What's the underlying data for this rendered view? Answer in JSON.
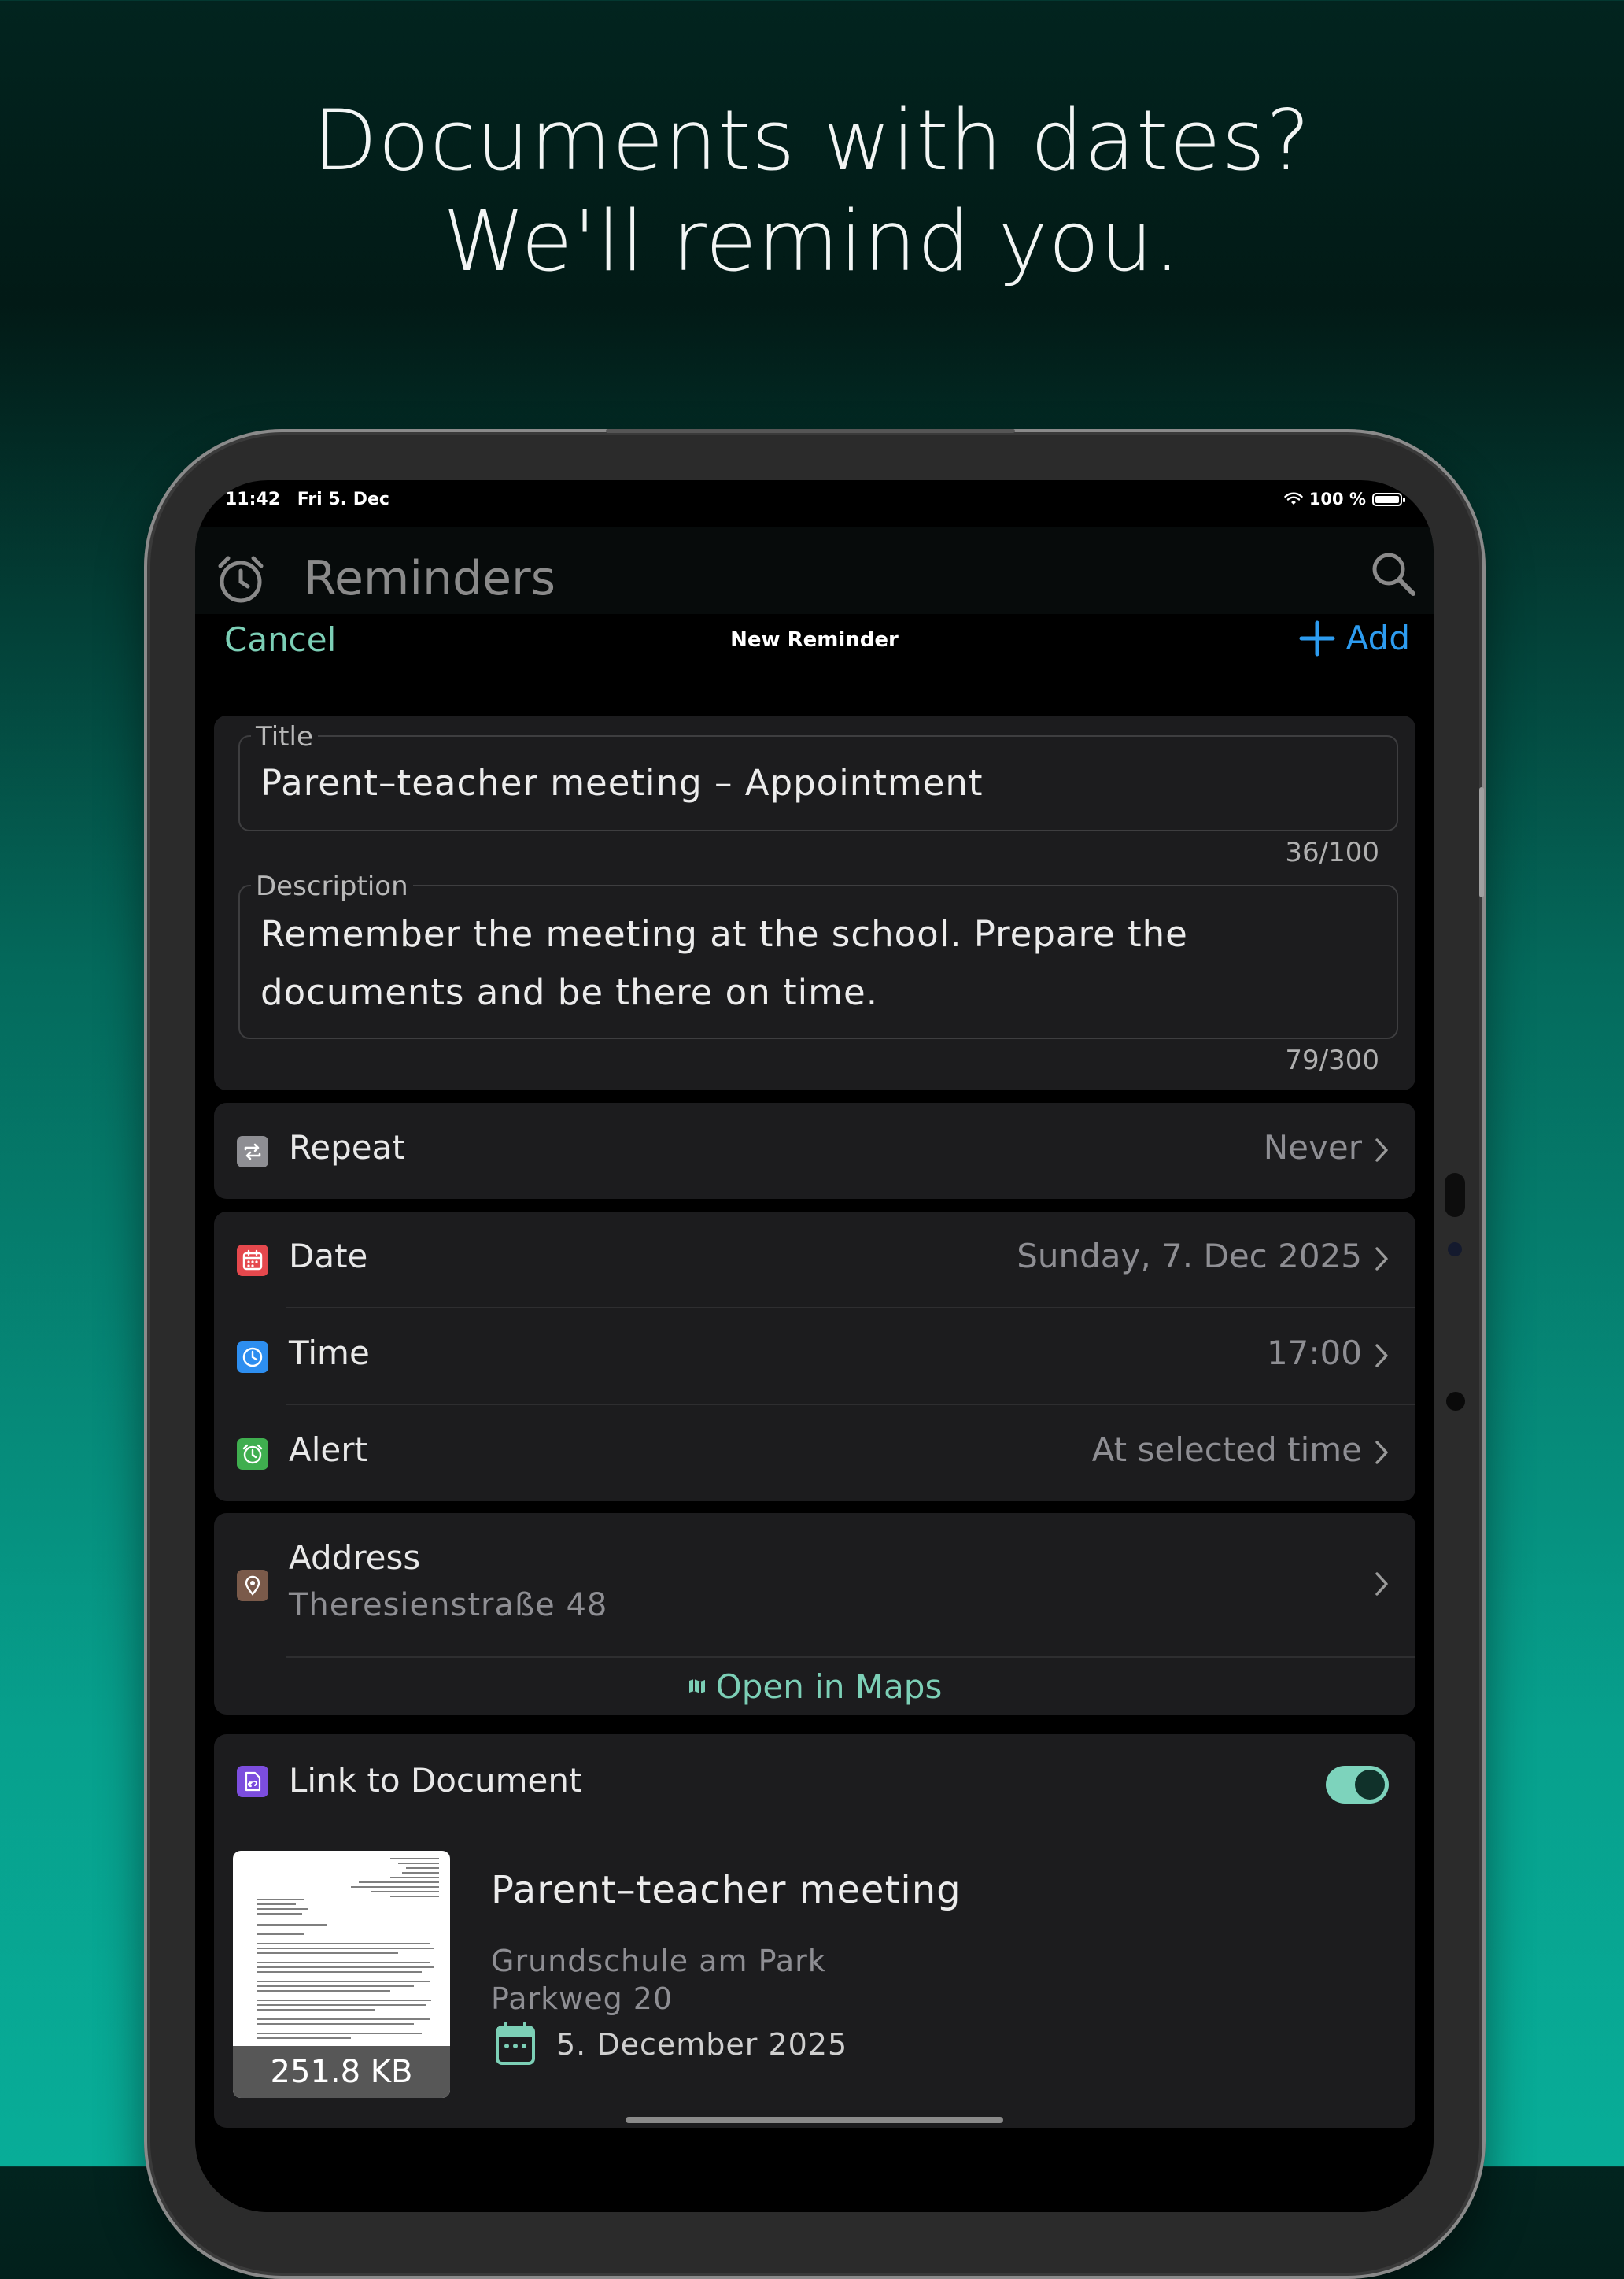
{
  "headline": {
    "line1": "Documents with dates?",
    "line2": "We'll remind you."
  },
  "status_bar": {
    "time": "11:42",
    "date": "Fri 5. Dec",
    "battery": "100 %"
  },
  "background_screen": {
    "title": "Reminders",
    "left_icon": "alarm-clock-icon",
    "right_icon": "search-icon"
  },
  "nav": {
    "cancel": "Cancel",
    "title": "New Reminder",
    "add": "Add",
    "add_icon": "plus-icon"
  },
  "form": {
    "title_label": "Title",
    "title_value": "Parent–teacher meeting – Appointment",
    "title_counter": "36/100",
    "description_label": "Description",
    "description_line1": "Remember the meeting at the school. Prepare the",
    "description_line2": "documents and be there on time.",
    "description_counter": "79/300"
  },
  "repeat": {
    "label": "Repeat",
    "value": "Never",
    "icon": "repeat-icon",
    "icon_color": "#8e8e93"
  },
  "date": {
    "label": "Date",
    "value": "Sunday, 7. Dec 2025",
    "icon": "calendar-icon",
    "icon_color": "#e5484d"
  },
  "time": {
    "label": "Time",
    "value": "17:00",
    "icon": "clock-icon",
    "icon_color": "#2d8ef0"
  },
  "alert": {
    "label": "Alert",
    "value": "At selected time",
    "icon": "alarm-icon",
    "icon_color": "#3fae4f"
  },
  "address": {
    "label": "Address",
    "value": "Theresienstraße 48",
    "icon": "location-pin-icon",
    "icon_color": "#7a5a4a",
    "open_maps": "Open in Maps",
    "open_maps_icon": "map-icon"
  },
  "link_document": {
    "label": "Link to Document",
    "icon": "document-link-icon",
    "icon_color": "#7c4dde",
    "enabled": true,
    "doc_title": "Parent–teacher meeting",
    "doc_line1": "Grundschule am Park",
    "doc_line2": "Parkweg 20",
    "doc_date": "5. December 2025",
    "doc_date_icon": "calendar-icon",
    "doc_size": "251.8 KB"
  },
  "colors": {
    "accent_teal": "#7ccfb6",
    "accent_blue": "#2d9cf0",
    "card_bg": "#1c1c1e"
  }
}
